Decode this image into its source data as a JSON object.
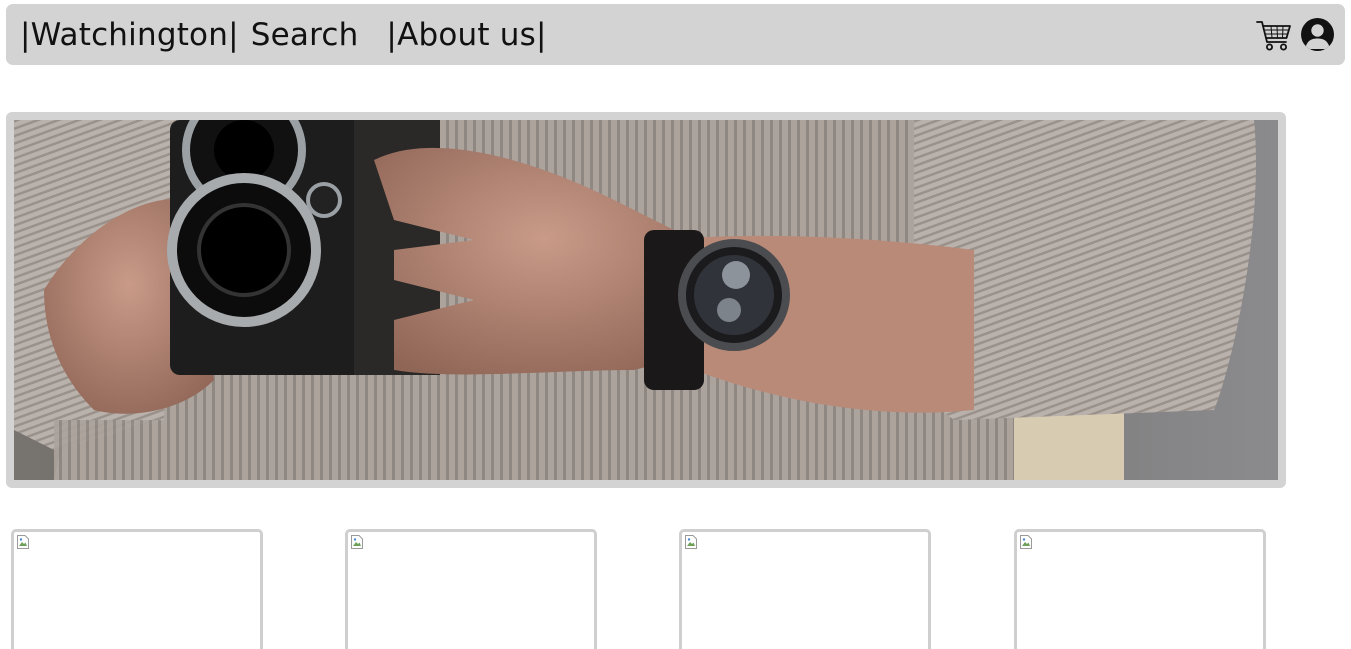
{
  "navbar": {
    "brand_label": "|Watchington|",
    "search_label": "Search",
    "about_label": "|About us|",
    "cart_icon": "shopping-cart-icon",
    "account_icon": "user-circle-icon"
  },
  "hero": {
    "image": "photo-hands-holding-camera-wearing-watch"
  },
  "products": [
    {
      "image": "broken-image-icon"
    },
    {
      "image": "broken-image-icon"
    },
    {
      "image": "broken-image-icon"
    },
    {
      "image": "broken-image-icon"
    }
  ],
  "colors": {
    "navbar_bg": "#d3d3d3",
    "text": "#111111",
    "card_border": "#cfcfcf",
    "page_bg": "#ffffff"
  }
}
